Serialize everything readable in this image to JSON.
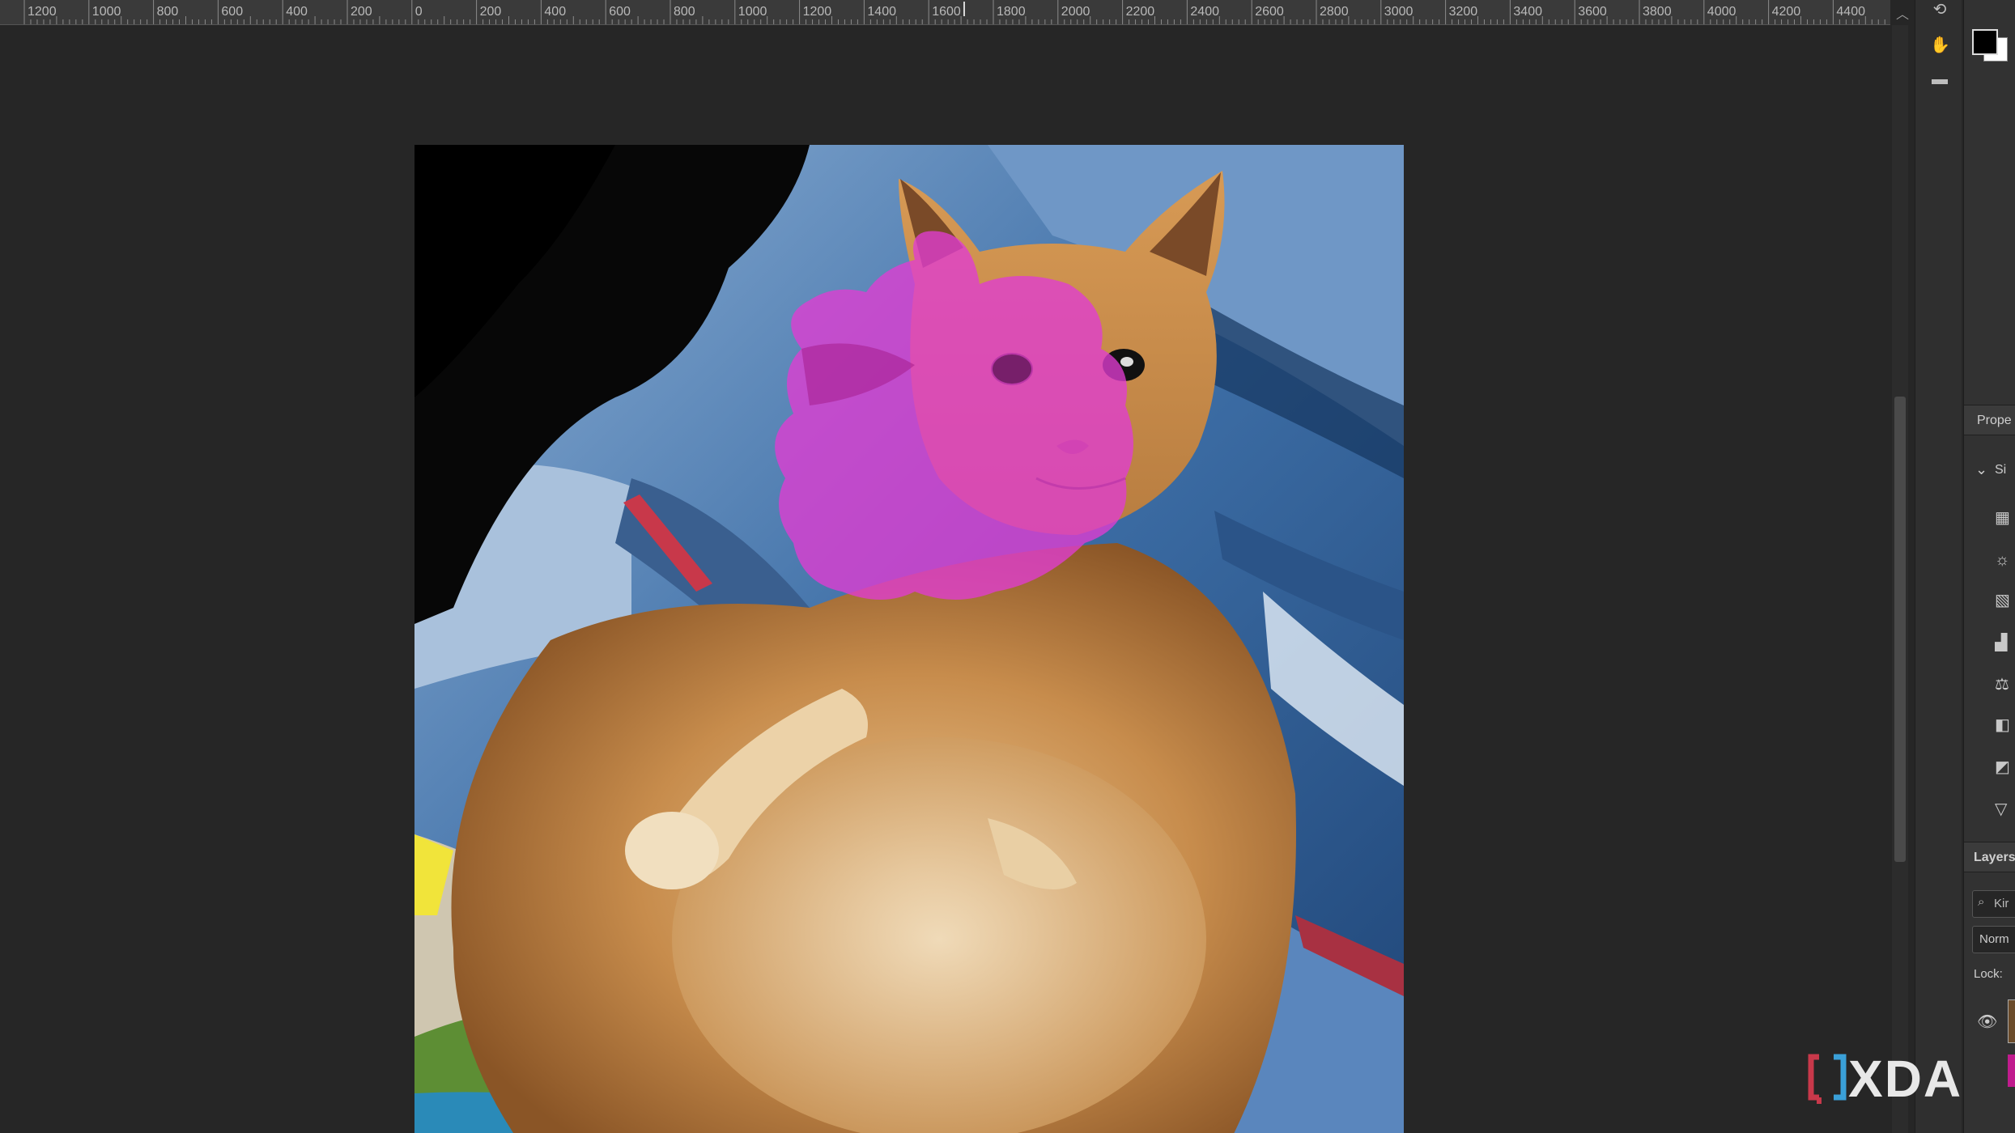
{
  "ruler": {
    "labels": [
      "1200",
      "1000",
      "800",
      "600",
      "400",
      "200",
      "0",
      "200",
      "400",
      "600",
      "800",
      "1000",
      "1200",
      "1400",
      "1600",
      "1800",
      "2000",
      "2200",
      "2400",
      "2600",
      "2800",
      "3000",
      "3200",
      "3400",
      "3600",
      "3800",
      "4000",
      "4200",
      "4400"
    ]
  },
  "panels": {
    "properties_title": "Prope",
    "section_label": "Si",
    "layers_title": "Layers",
    "kind_filter": "Kir",
    "blend_mode": "Norm",
    "lock_label": "Lock:"
  },
  "colors": {
    "foreground": "#000000",
    "background": "#ffffff",
    "quick_mask_overlay": "#e03cd2"
  },
  "watermark": {
    "text": "XDA"
  },
  "icons": [
    "rotate-view-icon",
    "hand-icon",
    "comment-icon",
    "brightness-icon",
    "curves-icon",
    "levels-icon",
    "color-balance-icon",
    "black-white-icon",
    "exposure-icon",
    "vibrance-icon",
    "search-icon",
    "eye-icon",
    "chevron-down-icon"
  ]
}
